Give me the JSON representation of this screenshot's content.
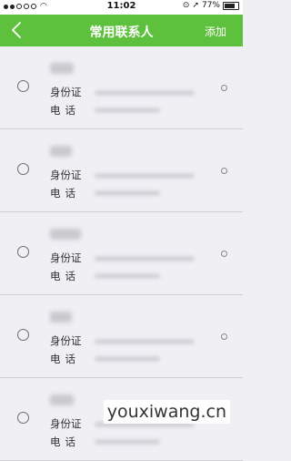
{
  "status_bar": {
    "time": "11:02",
    "battery": "77%"
  },
  "nav": {
    "title": "常用联系人",
    "add_label": "添加"
  },
  "contact_fields": {
    "id_label": "身份证",
    "phone_label": "电话"
  },
  "contacts": [
    {
      "name": "",
      "id_value": "",
      "phone_value": ""
    },
    {
      "name": "",
      "id_value": "",
      "phone_value": ""
    },
    {
      "name": "",
      "id_value": "",
      "phone_value": ""
    },
    {
      "name": "",
      "id_value": "",
      "phone_value": ""
    },
    {
      "name": "",
      "id_value": "",
      "phone_value": ""
    }
  ],
  "watermark": "youxiwang.cn",
  "colors": {
    "accent": "#5ec13d",
    "background": "#efeff4"
  },
  "icons": {
    "back": "chevron-left-icon",
    "row_select": "radio-icon",
    "row_action": "circle-dot-icon"
  }
}
